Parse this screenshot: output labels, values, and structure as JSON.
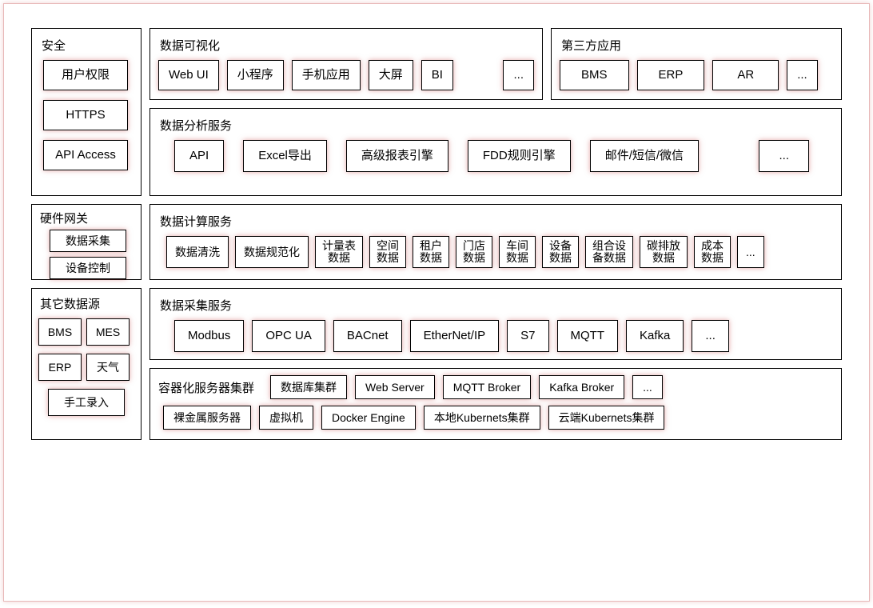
{
  "security": {
    "title": "安全",
    "items": [
      "用户权限",
      "HTTPS",
      "API Access"
    ]
  },
  "visualization": {
    "title": "数据可视化",
    "items": [
      "Web UI",
      "小程序",
      "手机应用",
      "大屏",
      "BI",
      "..."
    ]
  },
  "third_party": {
    "title": "第三方应用",
    "items": [
      "BMS",
      "ERP",
      "AR",
      "..."
    ]
  },
  "analysis": {
    "title": "数据分析服务",
    "items": [
      "API",
      "Excel导出",
      "高级报表引擎",
      "FDD规则引擎",
      "邮件/短信/微信",
      "..."
    ]
  },
  "gateway": {
    "title": "硬件网关",
    "items": [
      "数据采集",
      "设备控制"
    ]
  },
  "compute": {
    "title": "数据计算服务",
    "items": [
      "数据清洗",
      "数据规范化",
      "计量表\n数据",
      "空间\n数据",
      "租户\n数据",
      "门店\n数据",
      "车间\n数据",
      "设备\n数据",
      "组合设\n备数据",
      "碳排放\n数据",
      "成本\n数据",
      "..."
    ]
  },
  "other_sources": {
    "title": "其它数据源",
    "row1": [
      "BMS",
      "MES"
    ],
    "row2": [
      "ERP",
      "天气"
    ],
    "row3": [
      "手工录入"
    ]
  },
  "collection": {
    "title": "数据采集服务",
    "items": [
      "Modbus",
      "OPC UA",
      "BACnet",
      "EtherNet/IP",
      "S7",
      "MQTT",
      "Kafka",
      "..."
    ]
  },
  "cluster": {
    "title": "容器化服务器集群",
    "row1": [
      "数据库集群",
      "Web Server",
      "MQTT Broker",
      "Kafka  Broker",
      "..."
    ],
    "row2": [
      "裸金属服务器",
      "虚拟机",
      "Docker Engine",
      "本地Kubernets集群",
      "云端Kubernets集群"
    ]
  }
}
